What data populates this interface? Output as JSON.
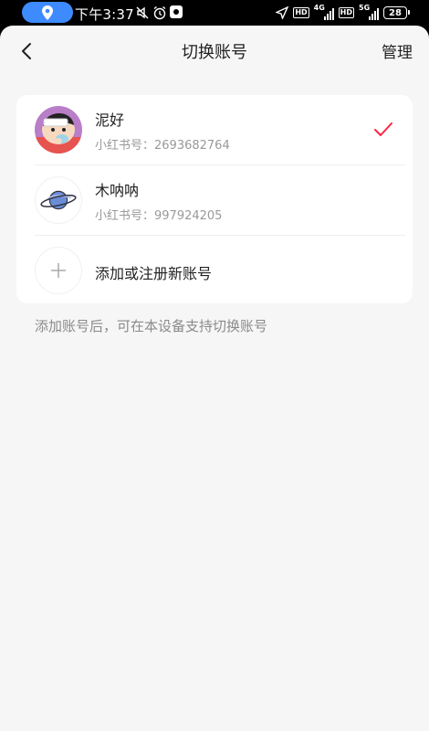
{
  "status_bar": {
    "time": "下午3:37",
    "network_badges": [
      "HD",
      "HD"
    ],
    "network_gen_1": "4G",
    "network_gen_2": "5G",
    "battery": "28"
  },
  "nav": {
    "title": "切换账号",
    "manage_label": "管理"
  },
  "accounts": [
    {
      "name": "泥好",
      "id_label": "小红书号：",
      "id_value": "2693682764",
      "selected": true
    },
    {
      "name": "木呐呐",
      "id_label": "小红书号：",
      "id_value": "997924205",
      "selected": false
    }
  ],
  "add_account_label": "添加或注册新账号",
  "hint_text": "添加账号后，可在本设备支持切换账号",
  "colors": {
    "accent": "#ff2442",
    "status_pill": "#3d8bff",
    "background": "#f6f6f6"
  }
}
